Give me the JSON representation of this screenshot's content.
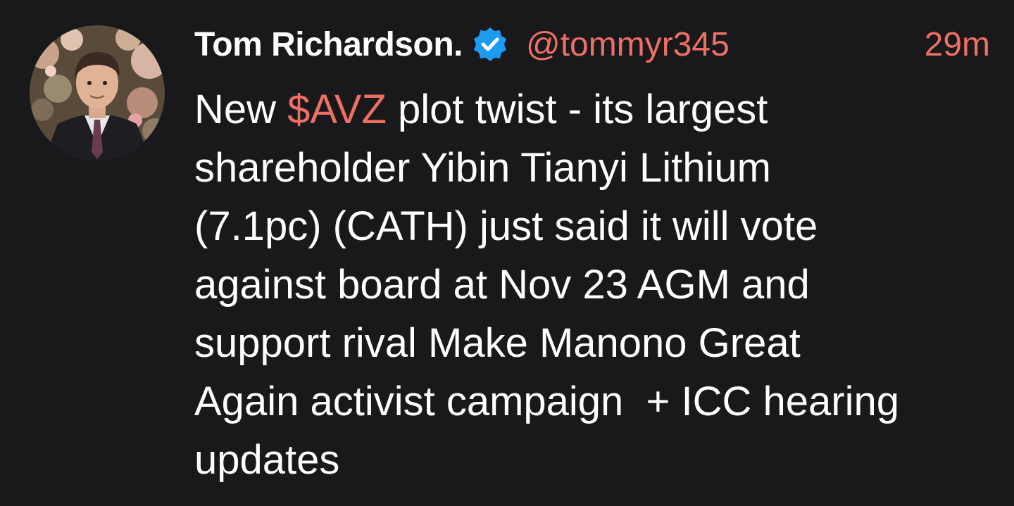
{
  "author": {
    "display_name": "Tom Richardson.",
    "handle": "@tommyr345",
    "verified_icon": "verified-badge-icon",
    "avatar_icon": "profile-photo"
  },
  "timestamp": "29m",
  "colors": {
    "background": "#19191b",
    "accent": "#ee6f63",
    "verified": "#1d9bf0",
    "text": "#ffffff"
  },
  "tweet": {
    "line1_before": "New ",
    "cashtag": "$AVZ",
    "line1_after": " plot twist - its largest",
    "line2": "shareholder Yibin Tianyi Lithium",
    "line3": "(7.1pc) (CATH) just said it will vote",
    "line4": "against board at Nov 23 AGM and",
    "line5": "support rival Make Manono Great",
    "line6": "Again activist campaign  + ICC hearing",
    "line7": "updates"
  }
}
